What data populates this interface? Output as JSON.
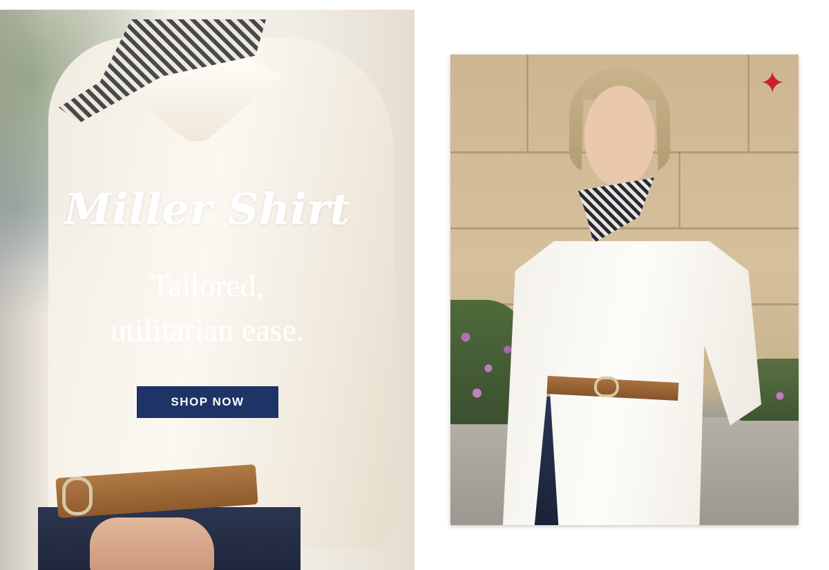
{
  "hero": {
    "title": "Miller Shirt",
    "subtitle_line1": "Tailored,",
    "subtitle_line2": "utilitarian ease.",
    "cta_label": "SHOP NOW"
  },
  "photo": {
    "star_glyph": "✦"
  },
  "colors": {
    "cta_background": "#1e3466",
    "star_accent": "#c8202c"
  }
}
